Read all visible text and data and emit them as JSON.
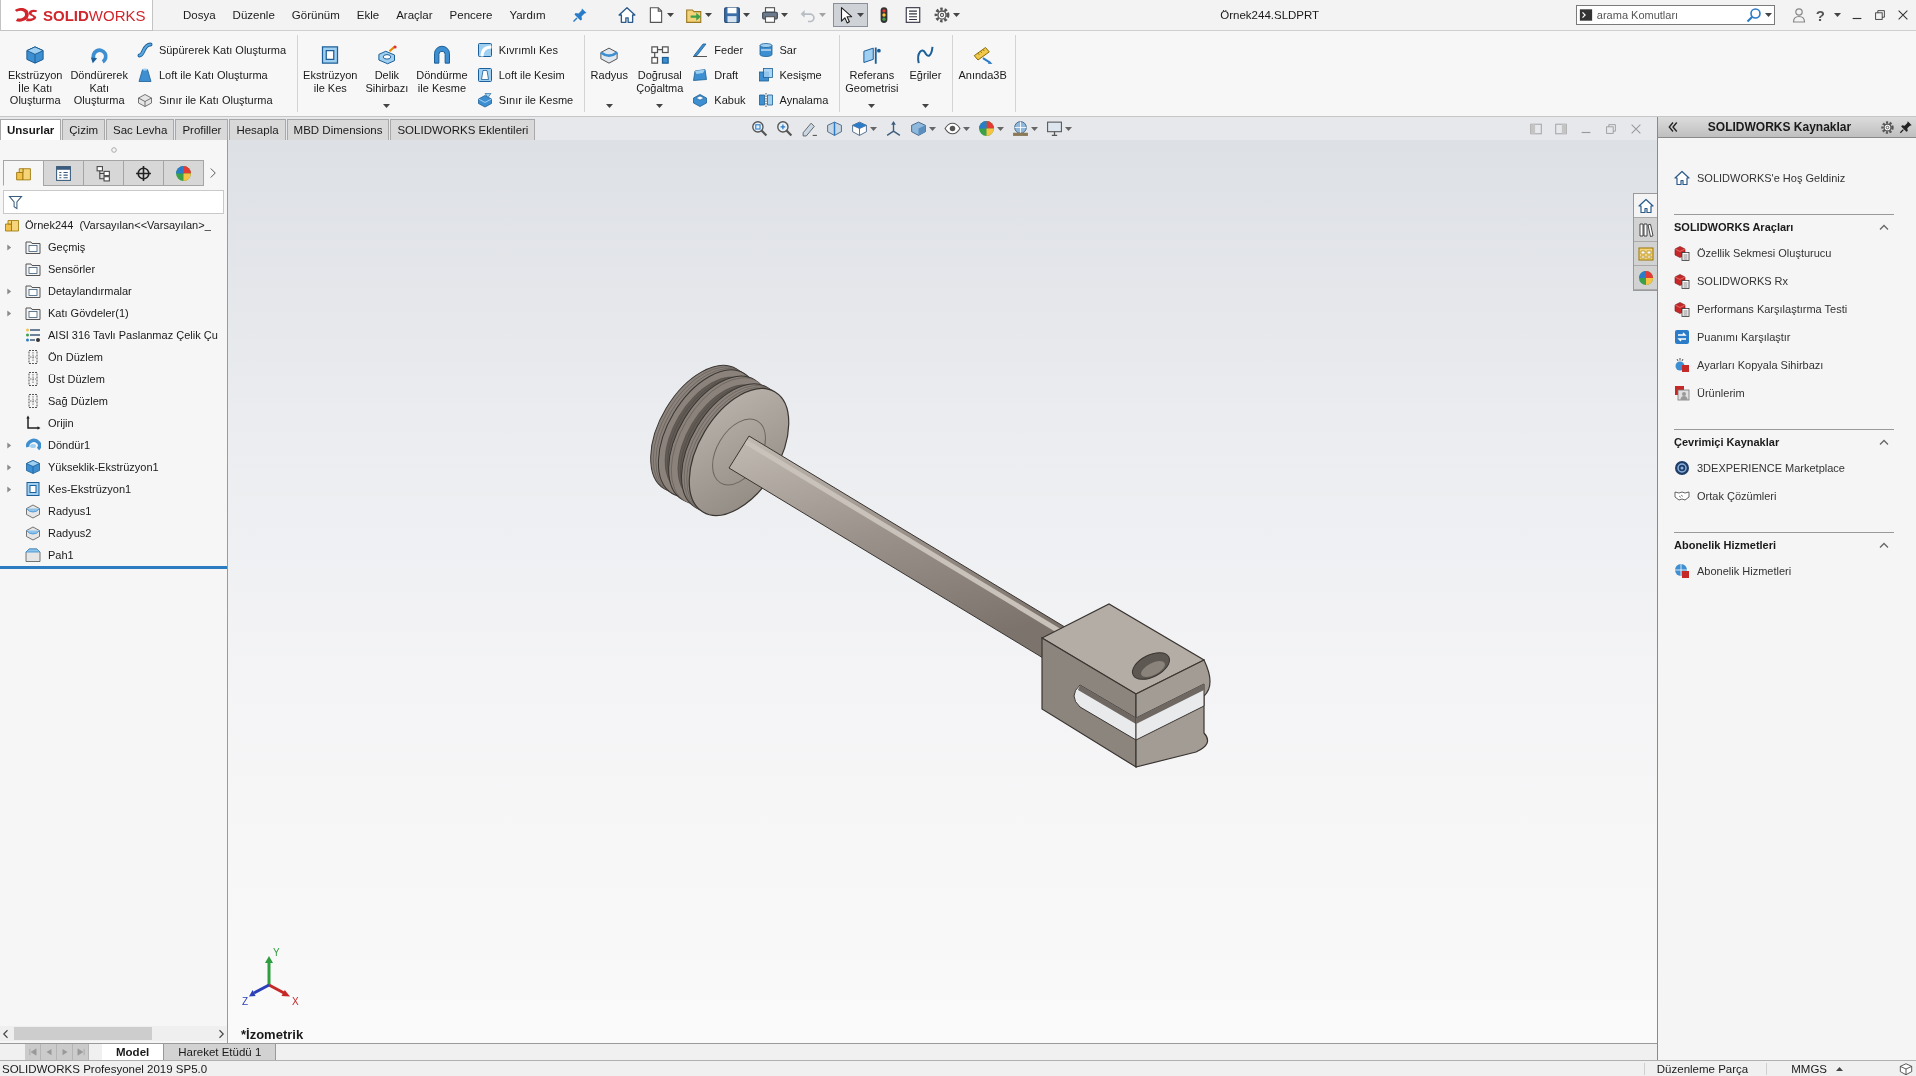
{
  "app": {
    "logo": "**SOLID**WORKS",
    "menu": [
      "Dosya",
      "Düzenle",
      "Görünüm",
      "Ekle",
      "Araçlar",
      "Pencere",
      "Yardım"
    ],
    "quick_access": [
      {
        "dropdown": false,
        "selected": false,
        "disabled": false
      },
      {
        "dropdown": true,
        "selected": false,
        "disabled": false
      },
      {
        "dropdown": true,
        "selected": false,
        "disabled": false
      },
      {
        "dropdown": true,
        "selected": false,
        "disabled": false
      },
      {
        "dropdown": true,
        "selected": false,
        "disabled": false
      },
      {
        "dropdown": true,
        "selected": false,
        "disabled": true
      },
      {
        "dropdown": true,
        "selected": true,
        "disabled": false
      },
      {
        "dropdown": false,
        "selected": false,
        "disabled": false
      },
      {
        "dropdown": false,
        "selected": false,
        "disabled": false
      },
      {
        "dropdown": true,
        "selected": false,
        "disabled": false
      }
    ],
    "document_title": "Örnek244.SLDPRT",
    "search": {
      "placeholder": "arama Komutları"
    },
    "help": "?"
  },
  "ribbon": {
    "groups": [
      {
        "large": [
          {
            "label": "Ekstrüzyon\nİle Katı\nOluşturma",
            "dropdown": false
          },
          {
            "label": "Döndürerek\nKatı\nOluşturma",
            "dropdown": false
          }
        ],
        "stacks": [
          [
            "Süpürerek Katı Oluşturma",
            "Loft ile Katı Oluşturma",
            "Sınır ile Katı Oluşturma"
          ]
        ]
      },
      {
        "large": [
          {
            "label": "Ekstrüzyon\nile Kes",
            "dropdown": false
          },
          {
            "label": "Delik\nSihirbazı",
            "dropdown": true
          },
          {
            "label": "Döndürme\nile Kesme",
            "dropdown": false
          }
        ],
        "stacks": [
          [
            "Kıvrımlı Kes",
            "Loft ile Kesim",
            "Sınır ile Kesme"
          ]
        ]
      },
      {
        "large": [
          {
            "label": "Radyus",
            "dropdown": true
          },
          {
            "label": "Doğrusal\nÇoğaltma",
            "dropdown": true
          }
        ],
        "stacks": [
          [
            "Feder",
            "Draft",
            "Kabuk"
          ],
          [
            "Sar",
            "Kesişme",
            "Aynalama"
          ]
        ]
      },
      {
        "large": [
          {
            "label": "Referans\nGeometrisi",
            "dropdown": true
          },
          {
            "label": "Eğriler",
            "dropdown": true
          }
        ]
      },
      {
        "large": [
          {
            "label": "Anında3B",
            "dropdown": false
          }
        ]
      }
    ]
  },
  "command_tabs": [
    {
      "label": "Unsurlar",
      "selected": true
    },
    {
      "label": "Çizim",
      "selected": false
    },
    {
      "label": "Sac Levha",
      "selected": false
    },
    {
      "label": "Profiller",
      "selected": false
    },
    {
      "label": "Hesapla",
      "selected": false
    },
    {
      "label": "MBD Dimensions",
      "selected": false
    },
    {
      "label": "SOLIDWORKS Eklentileri",
      "selected": false
    }
  ],
  "view_toolbar": [
    {
      "dropdown": false
    },
    {
      "dropdown": false
    },
    {
      "dropdown": false
    },
    {
      "dropdown": false
    },
    {
      "dropdown": true
    },
    {
      "dropdown": false
    },
    {
      "dropdown": true
    },
    {
      "dropdown": true
    },
    {
      "dropdown": true
    },
    {
      "dropdown": true
    },
    {
      "dropdown": true
    }
  ],
  "feature_manager": {
    "panel_tabs": [
      {
        "selected": true
      },
      {
        "selected": false
      },
      {
        "selected": false
      },
      {
        "selected": false
      },
      {
        "selected": false
      }
    ],
    "tree": [
      {
        "label": "Örnek244  (Varsayılan<<Varsayılan>_",
        "kind": "part",
        "children": [
          {
            "label": "Geçmiş",
            "kind": "folder",
            "expanded": false
          },
          {
            "label": "Sensörler",
            "kind": "folder"
          },
          {
            "label": "Detaylandırmalar",
            "kind": "folder",
            "expanded": false
          },
          {
            "label": "Katı Gövdeler(1)",
            "kind": "folder",
            "expanded": false
          },
          {
            "label": "AISI 316 Tavlı Paslanmaz Çelik Çu",
            "kind": "material"
          },
          {
            "label": "Ön Düzlem",
            "kind": "plane"
          },
          {
            "label": "Üst Düzlem",
            "kind": "plane"
          },
          {
            "label": "Sağ Düzlem",
            "kind": "plane"
          },
          {
            "label": "Orijin",
            "kind": "origin"
          },
          {
            "label": "Döndür1",
            "kind": "revolve",
            "expanded": false
          },
          {
            "label": "Yükseklik-Ekstrüzyon1",
            "kind": "extrude",
            "expanded": false
          },
          {
            "label": "Kes-Ekstrüzyon1",
            "kind": "cut",
            "expanded": false
          },
          {
            "label": "Radyus1",
            "kind": "fillet"
          },
          {
            "label": "Radyus2",
            "kind": "fillet"
          },
          {
            "label": "Pah1",
            "kind": "chamfer"
          }
        ]
      }
    ]
  },
  "graphics": {
    "view_name": "*İzometrik",
    "triad": [
      "Y",
      "Z",
      "X"
    ]
  },
  "task_pane": {
    "title": "SOLIDWORKS Kaynaklar",
    "tabs": [
      {
        "selected": true
      },
      {
        "selected": false
      },
      {
        "selected": false
      },
      {
        "selected": false
      }
    ],
    "welcome": "SOLIDWORKS'e Hoş Geldiniz",
    "sections": [
      {
        "title": "SOLIDWORKS Araçları",
        "expanded": true,
        "items": [
          "Özellik Sekmesi Oluşturucu",
          "SOLIDWORKS Rx",
          "Performans Karşılaştırma Testi",
          "Puanımı Karşılaştır",
          "Ayarları Kopyala Sihirbazı",
          "Ürünlerim"
        ]
      },
      {
        "title": "Çevrimiçi Kaynaklar",
        "expanded": true,
        "items": [
          "3DEXPERIENCE Marketplace",
          "Ortak Çözümleri"
        ]
      },
      {
        "title": "Abonelik Hizmetleri",
        "expanded": true,
        "items": [
          "Abonelik Hizmetleri"
        ]
      }
    ]
  },
  "bottom_tabs": [
    {
      "label": "Model",
      "selected": true
    },
    {
      "label": "Hareket Etüdü 1",
      "selected": false
    }
  ],
  "status_bar": {
    "product": "SOLIDWORKS Profesyonel 2019 SP5.0",
    "mode": "Düzenleme Parça",
    "units": "MMGS"
  }
}
